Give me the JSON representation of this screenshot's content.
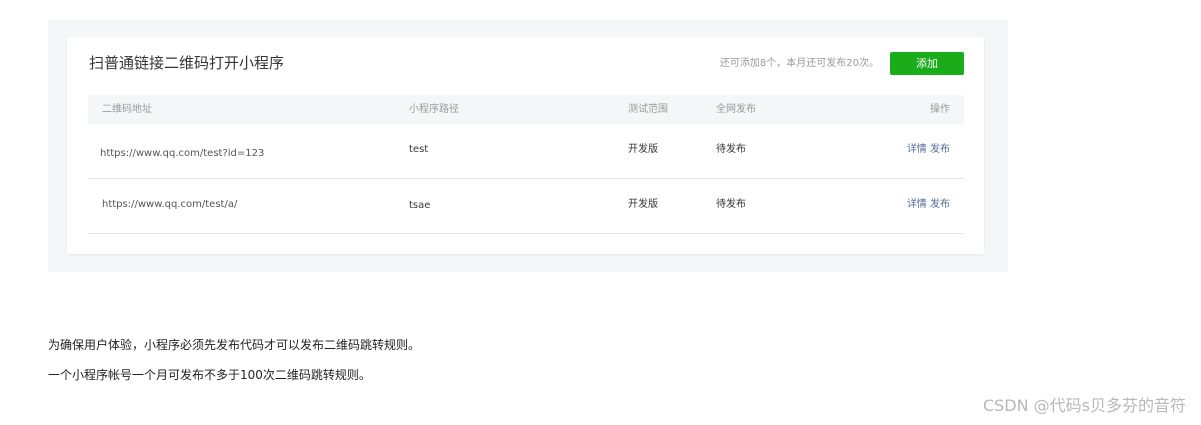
{
  "card": {
    "title": "扫普通链接二维码打开小程序",
    "quota": "还可添加8个，本月还可发布20次。",
    "add_label": "添加"
  },
  "table": {
    "headers": {
      "url": "二维码地址",
      "path": "小程序路径",
      "test_scope": "测试范围",
      "release": "全网发布",
      "ops": "操作"
    },
    "rows": [
      {
        "url": "https://www.qq.com/test?id=123",
        "path": "test",
        "test_scope": "开发版",
        "release": "待发布",
        "detail": "详情",
        "publish": "发布"
      },
      {
        "url": "https://www.qq.com/test/a/",
        "path": "tsae",
        "test_scope": "开发版",
        "release": "待发布",
        "detail": "详情",
        "publish": "发布"
      }
    ]
  },
  "notes": [
    "为确保用户体验，小程序必须先发布代码才可以发布二维码跳转规则。",
    "一个小程序帐号一个月可发布不多于100次二维码跳转规则。"
  ],
  "watermark": "CSDN @代码s贝多芬的音符",
  "colors": {
    "accent_green": "#1aad19",
    "link_blue": "#576b95",
    "panel_gray": "#f5f6f7"
  }
}
